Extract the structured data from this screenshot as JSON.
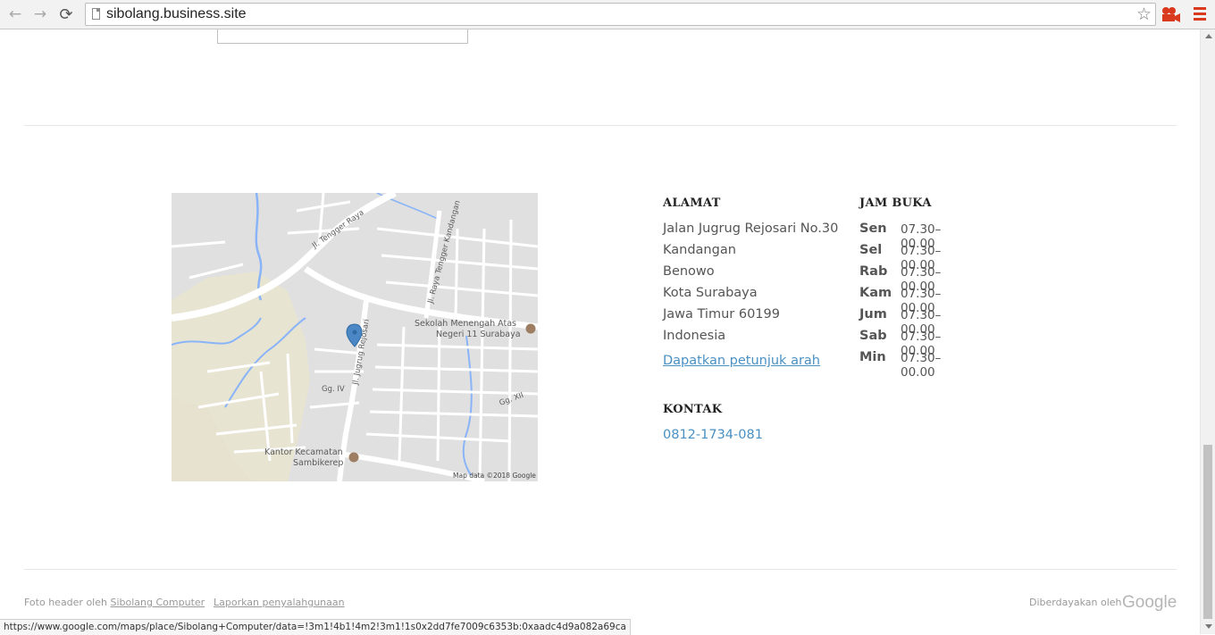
{
  "browser": {
    "url": "sibolang.business.site",
    "back_glyph": "←",
    "forward_glyph": "→",
    "reload_glyph": "⟳",
    "star_glyph": "☆"
  },
  "map": {
    "labels": {
      "tengger": "Jl. Tengger Raya",
      "kandangan": "Jl. Raya Tengger Kandangan",
      "sma_line1": "Sekolah Menengah Atas",
      "sma_line2": "Negeri 11 Surabaya",
      "jugrug": "Jl. Jugrug Rejosari",
      "gg4": "Gg. IV",
      "gg12": "Gg. XII",
      "kantor_line1": "Kantor Kecamatan",
      "kantor_line2": "Sambikerep",
      "attribution": "Map data ©2018 Google"
    }
  },
  "address": {
    "heading": "ALAMAT",
    "lines": [
      "Jalan Jugrug Rejosari No.30",
      "Kandangan",
      "Benowo",
      "Kota Surabaya",
      "Jawa Timur 60199",
      "Indonesia"
    ],
    "directions_link": "Dapatkan petunjuk arah"
  },
  "hours": {
    "heading": "JAM BUKA",
    "rows": [
      {
        "day": "Sen",
        "time": "07.30–00.00"
      },
      {
        "day": "Sel",
        "time": "07.30–00.00"
      },
      {
        "day": "Rab",
        "time": "07.30–00.00"
      },
      {
        "day": "Kam",
        "time": "07.30–00.00"
      },
      {
        "day": "Jum",
        "time": "07.30–00.00"
      },
      {
        "day": "Sab",
        "time": "07.30–00.00"
      },
      {
        "day": "Min",
        "time": "07.30–00.00"
      }
    ]
  },
  "contact": {
    "heading": "KONTAK",
    "phone": "0812-1734-081"
  },
  "footer": {
    "photo_prefix": "Foto header oleh",
    "photo_link": "Sibolang Computer",
    "report_link": "Laporkan penyalahgunaan",
    "powered_by": "Diberdayakan oleh",
    "google_word": "Google"
  },
  "status_bar": {
    "text": "https://www.google.com/maps/place/Sibolang+Computer/data=!3m1!4b1!4m2!3m1!1s0x2dd7fe7009c6353b:0xaadc4d9a082a69ca"
  },
  "colors": {
    "link": "#4a90c2",
    "map_pin": "#4a87c4",
    "browser_menu": "#d9391c"
  }
}
